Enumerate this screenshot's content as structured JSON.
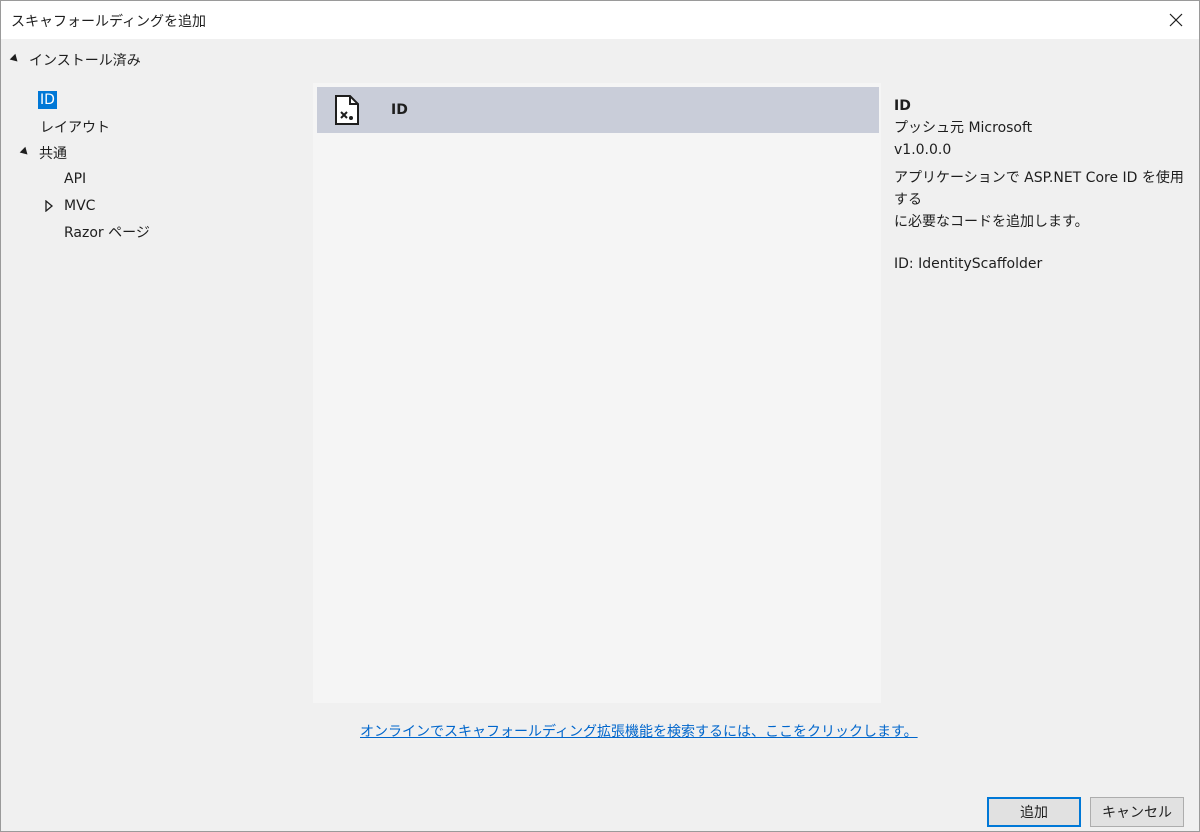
{
  "window": {
    "title": "スキャフォールディングを追加"
  },
  "tree": {
    "root": "インストール済み",
    "items": [
      {
        "label": "ID"
      },
      {
        "label": "レイアウト"
      },
      {
        "label": "共通"
      },
      {
        "label": "API"
      },
      {
        "label": "MVC"
      },
      {
        "label": "Razor ページ"
      }
    ]
  },
  "list": {
    "items": [
      {
        "label": "ID"
      }
    ]
  },
  "details": {
    "name": "ID",
    "publisher": "プッシュ元 Microsoft",
    "version": "v1.0.0.0",
    "description_line1": "アプリケーションで ASP.NET Core ID を使用する",
    "description_line2": "に必要なコードを追加します。",
    "id": "ID: IdentityScaffolder"
  },
  "online_link": "オンラインでスキャフォールディング拡張機能を検索するには、ここをクリックします。",
  "buttons": {
    "add": "追加",
    "cancel": "キャンセル"
  },
  "colors": {
    "accent": "#0078d7",
    "selected_row": "#c9cdd9",
    "link": "#0066cc"
  }
}
